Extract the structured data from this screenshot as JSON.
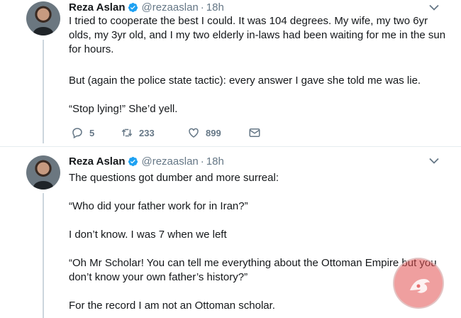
{
  "tweets": [
    {
      "name": "Reza Aslan",
      "handle": "@rezaaslan",
      "dot": "·",
      "time": "18h",
      "paragraphs": [
        "I tried to cooperate the best I could. It was 104 degrees. My wife, my two 6yr olds, my 3yr old, and I my two elderly in-laws had been waiting for me in the sun for hours.",
        "But (again the police state tactic): every answer I gave she told me was lie.",
        "“Stop lying!” She’d yell."
      ],
      "actions": {
        "replies": "5",
        "retweets": "233",
        "likes": "899"
      }
    },
    {
      "name": "Reza Aslan",
      "handle": "@rezaaslan",
      "dot": "·",
      "time": "18h",
      "paragraphs": [
        "The questions got dumber and more surreal:",
        "“Who did your father work for in Iran?”",
        "I don’t know. I was 7 when we left",
        "“Oh Mr Scholar! You can tell me everything about the Ottoman Empire but you don’t know your own father’s history?”",
        "For the record I am not an Ottoman scholar."
      ]
    }
  ],
  "colors": {
    "verified": "#1da1f2",
    "muted": "#657786",
    "text": "#14171a",
    "thread_line": "#ccd6dd",
    "watermark": "#e25050"
  },
  "icons": {
    "verified": "verified-badge-icon",
    "caret": "chevron-down-icon",
    "reply": "reply-icon",
    "retweet": "retweet-icon",
    "like": "heart-icon",
    "dm": "envelope-icon",
    "watermark": "watermark-logo"
  }
}
